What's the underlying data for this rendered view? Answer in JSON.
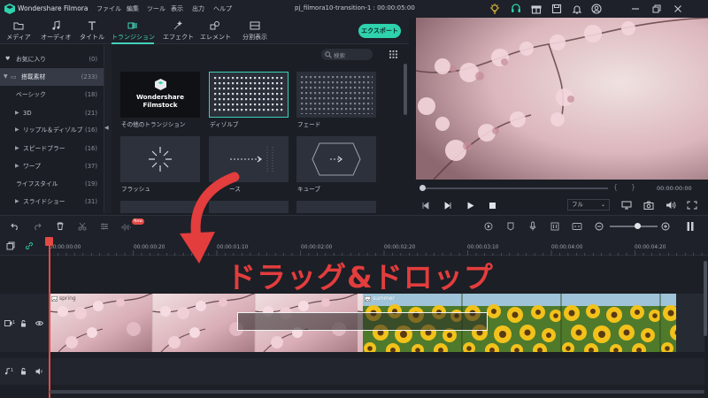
{
  "titlebar": {
    "app_name": "Wondershare Filmora",
    "menu": [
      "ファイル",
      "編集",
      "ツール",
      "表示",
      "出力",
      "ヘルプ"
    ],
    "project_title": "pj_filmora10-transition-1 : 00:00:05:00"
  },
  "toolbar": {
    "tabs": [
      {
        "label": "メディア",
        "icon": "folder-icon"
      },
      {
        "label": "オーディオ",
        "icon": "music-note-icon"
      },
      {
        "label": "タイトル",
        "icon": "text-icon"
      },
      {
        "label": "トランジション",
        "icon": "transition-icon"
      },
      {
        "label": "エフェクト",
        "icon": "effects-icon"
      },
      {
        "label": "エレメント",
        "icon": "element-icon"
      },
      {
        "label": "分割表示",
        "icon": "split-screen-icon"
      }
    ],
    "active_tab": "トランジション",
    "export_label": "エクスポート",
    "accent": "#43d1b9"
  },
  "categories": [
    {
      "name": "お気に入り",
      "count": "(0)"
    },
    {
      "name": "搭載素材",
      "count": "(233)"
    },
    {
      "name": "ベーシック",
      "count": "(18)"
    },
    {
      "name": "3D",
      "count": "(21)"
    },
    {
      "name": "リップル＆ディゾルブ",
      "count": "(16)"
    },
    {
      "name": "スピードブラー",
      "count": "(16)"
    },
    {
      "name": "ワープ",
      "count": "(37)"
    },
    {
      "name": "ライフスタイル",
      "count": "(19)"
    },
    {
      "name": "スライドショー",
      "count": "(31)"
    }
  ],
  "search": {
    "placeholder": "検索"
  },
  "transitions": [
    {
      "label": "その他のトランジション",
      "overlay": "Wondershare Filmstock"
    },
    {
      "label": "ディゾルブ"
    },
    {
      "label": "フェード"
    },
    {
      "label": "フラッシュ"
    },
    {
      "label": "ース"
    },
    {
      "label": "キューブ"
    }
  ],
  "preview": {
    "time": "00:00:00:00",
    "quality": "フル",
    "progress": 0.0
  },
  "timeline": {
    "ruler": [
      "00:00:00:00",
      "00:00:00:20",
      "00:00:01:10",
      "00:00:02:00",
      "00:00:02:20",
      "00:00:03:10",
      "00:00:04:00",
      "00:00:04:20"
    ],
    "new_badge": "New",
    "clips": [
      {
        "name": "spring"
      },
      {
        "name": "summer"
      }
    ],
    "track_numbers": {
      "video": "1",
      "audio": "1"
    }
  },
  "annotation": {
    "text": "ドラッグ&ドロップ",
    "color": "#e33d3d"
  }
}
